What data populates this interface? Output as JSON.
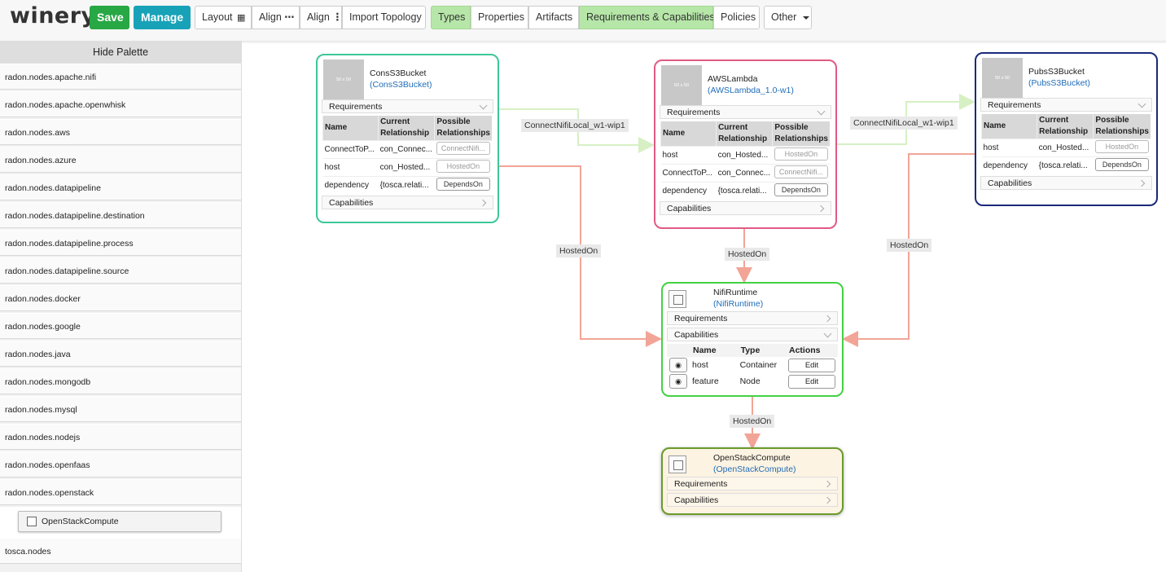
{
  "toolbar": {
    "logo": "winery",
    "save": "Save",
    "manage": "Manage",
    "layout": "Layout",
    "align_h": "Align",
    "align_v": "Align",
    "import_topology": "Import Topology",
    "types": "Types",
    "properties": "Properties",
    "artifacts": "Artifacts",
    "req_caps": "Requirements & Capabilities",
    "policies": "Policies",
    "other": "Other",
    "active_color": "#b6e6a8"
  },
  "palette": {
    "header": "Hide Palette",
    "items": [
      "radon.nodes.apache.nifi",
      "radon.nodes.apache.openwhisk",
      "radon.nodes.aws",
      "radon.nodes.azure",
      "radon.nodes.datapipeline",
      "radon.nodes.datapipeline.destination",
      "radon.nodes.datapipeline.process",
      "radon.nodes.datapipeline.source",
      "radon.nodes.docker",
      "radon.nodes.google",
      "radon.nodes.java",
      "radon.nodes.mongodb",
      "radon.nodes.mysql",
      "radon.nodes.nodejs",
      "radon.nodes.openfaas",
      "radon.nodes.openstack"
    ],
    "sub_item": "OpenStackCompute",
    "last_item": "tosca.nodes"
  },
  "nodes": {
    "cons": {
      "name": "ConsS3Bucket",
      "type": "(ConsS3Bucket)",
      "thumb": "50 x 50",
      "border": "#3cc79a",
      "requirements": "Requirements",
      "capabilities": "Capabilities",
      "cols": [
        "Name",
        "Current Relationship",
        "Possible Relationships"
      ],
      "rows": [
        {
          "name": "ConnectToP...",
          "current": "con_Connec...",
          "possible": "ConnectNifi..."
        },
        {
          "name": "host",
          "current": "con_Hosted...",
          "possible": "HostedOn"
        },
        {
          "name": "dependency",
          "current": "{tosca.relati...",
          "possible": "DependsOn"
        }
      ]
    },
    "lambda": {
      "name": "AWSLambda",
      "type": "(AWSLambda_1.0-w1)",
      "thumb": "50 x 50",
      "border": "#e05a84",
      "requirements": "Requirements",
      "capabilities": "Capabilities",
      "cols": [
        "Name",
        "Current Relationship",
        "Possible Relationships"
      ],
      "rows": [
        {
          "name": "host",
          "current": "con_Hosted...",
          "possible": "HostedOn"
        },
        {
          "name": "ConnectToP...",
          "current": "con_Connec...",
          "possible": "ConnectNifi..."
        },
        {
          "name": "dependency",
          "current": "{tosca.relati...",
          "possible": "DependsOn"
        }
      ]
    },
    "pubs": {
      "name": "PubsS3Bucket",
      "type": "(PubsS3Bucket)",
      "thumb": "50 x 50",
      "border": "#1a2a7a",
      "requirements": "Requirements",
      "capabilities": "Capabilities",
      "cols": [
        "Name",
        "Current Relationship",
        "Possible Relationships"
      ],
      "rows": [
        {
          "name": "host",
          "current": "con_Hosted...",
          "possible": "HostedOn"
        },
        {
          "name": "dependency",
          "current": "{tosca.relati...",
          "possible": "DependsOn"
        }
      ]
    },
    "nifi": {
      "name": "NifiRuntime",
      "type": "(NifiRuntime)",
      "border": "#43d143",
      "requirements": "Requirements",
      "capabilities": "Capabilities",
      "cols": [
        "Name",
        "Type",
        "Actions"
      ],
      "rows": [
        {
          "name": "host",
          "type": "Container",
          "action": "Edit"
        },
        {
          "name": "feature",
          "type": "Node",
          "action": "Edit"
        }
      ]
    },
    "openstack": {
      "name": "OpenStackCompute",
      "type": "(OpenStackCompute)",
      "border": "#6a9a2a",
      "bg": "#fdf3e3",
      "requirements": "Requirements",
      "capabilities": "Capabilities"
    }
  },
  "edges": {
    "connect1": "ConnectNifiLocal_w1-wip1",
    "connect2": "ConnectNifiLocal_w1-wip1",
    "hosted1": "HostedOn",
    "hosted2": "HostedOn",
    "hosted3": "HostedOn",
    "hosted4": "HostedOn",
    "connect_color": "#d6f0c4",
    "hosted_color": "#f2a596"
  }
}
